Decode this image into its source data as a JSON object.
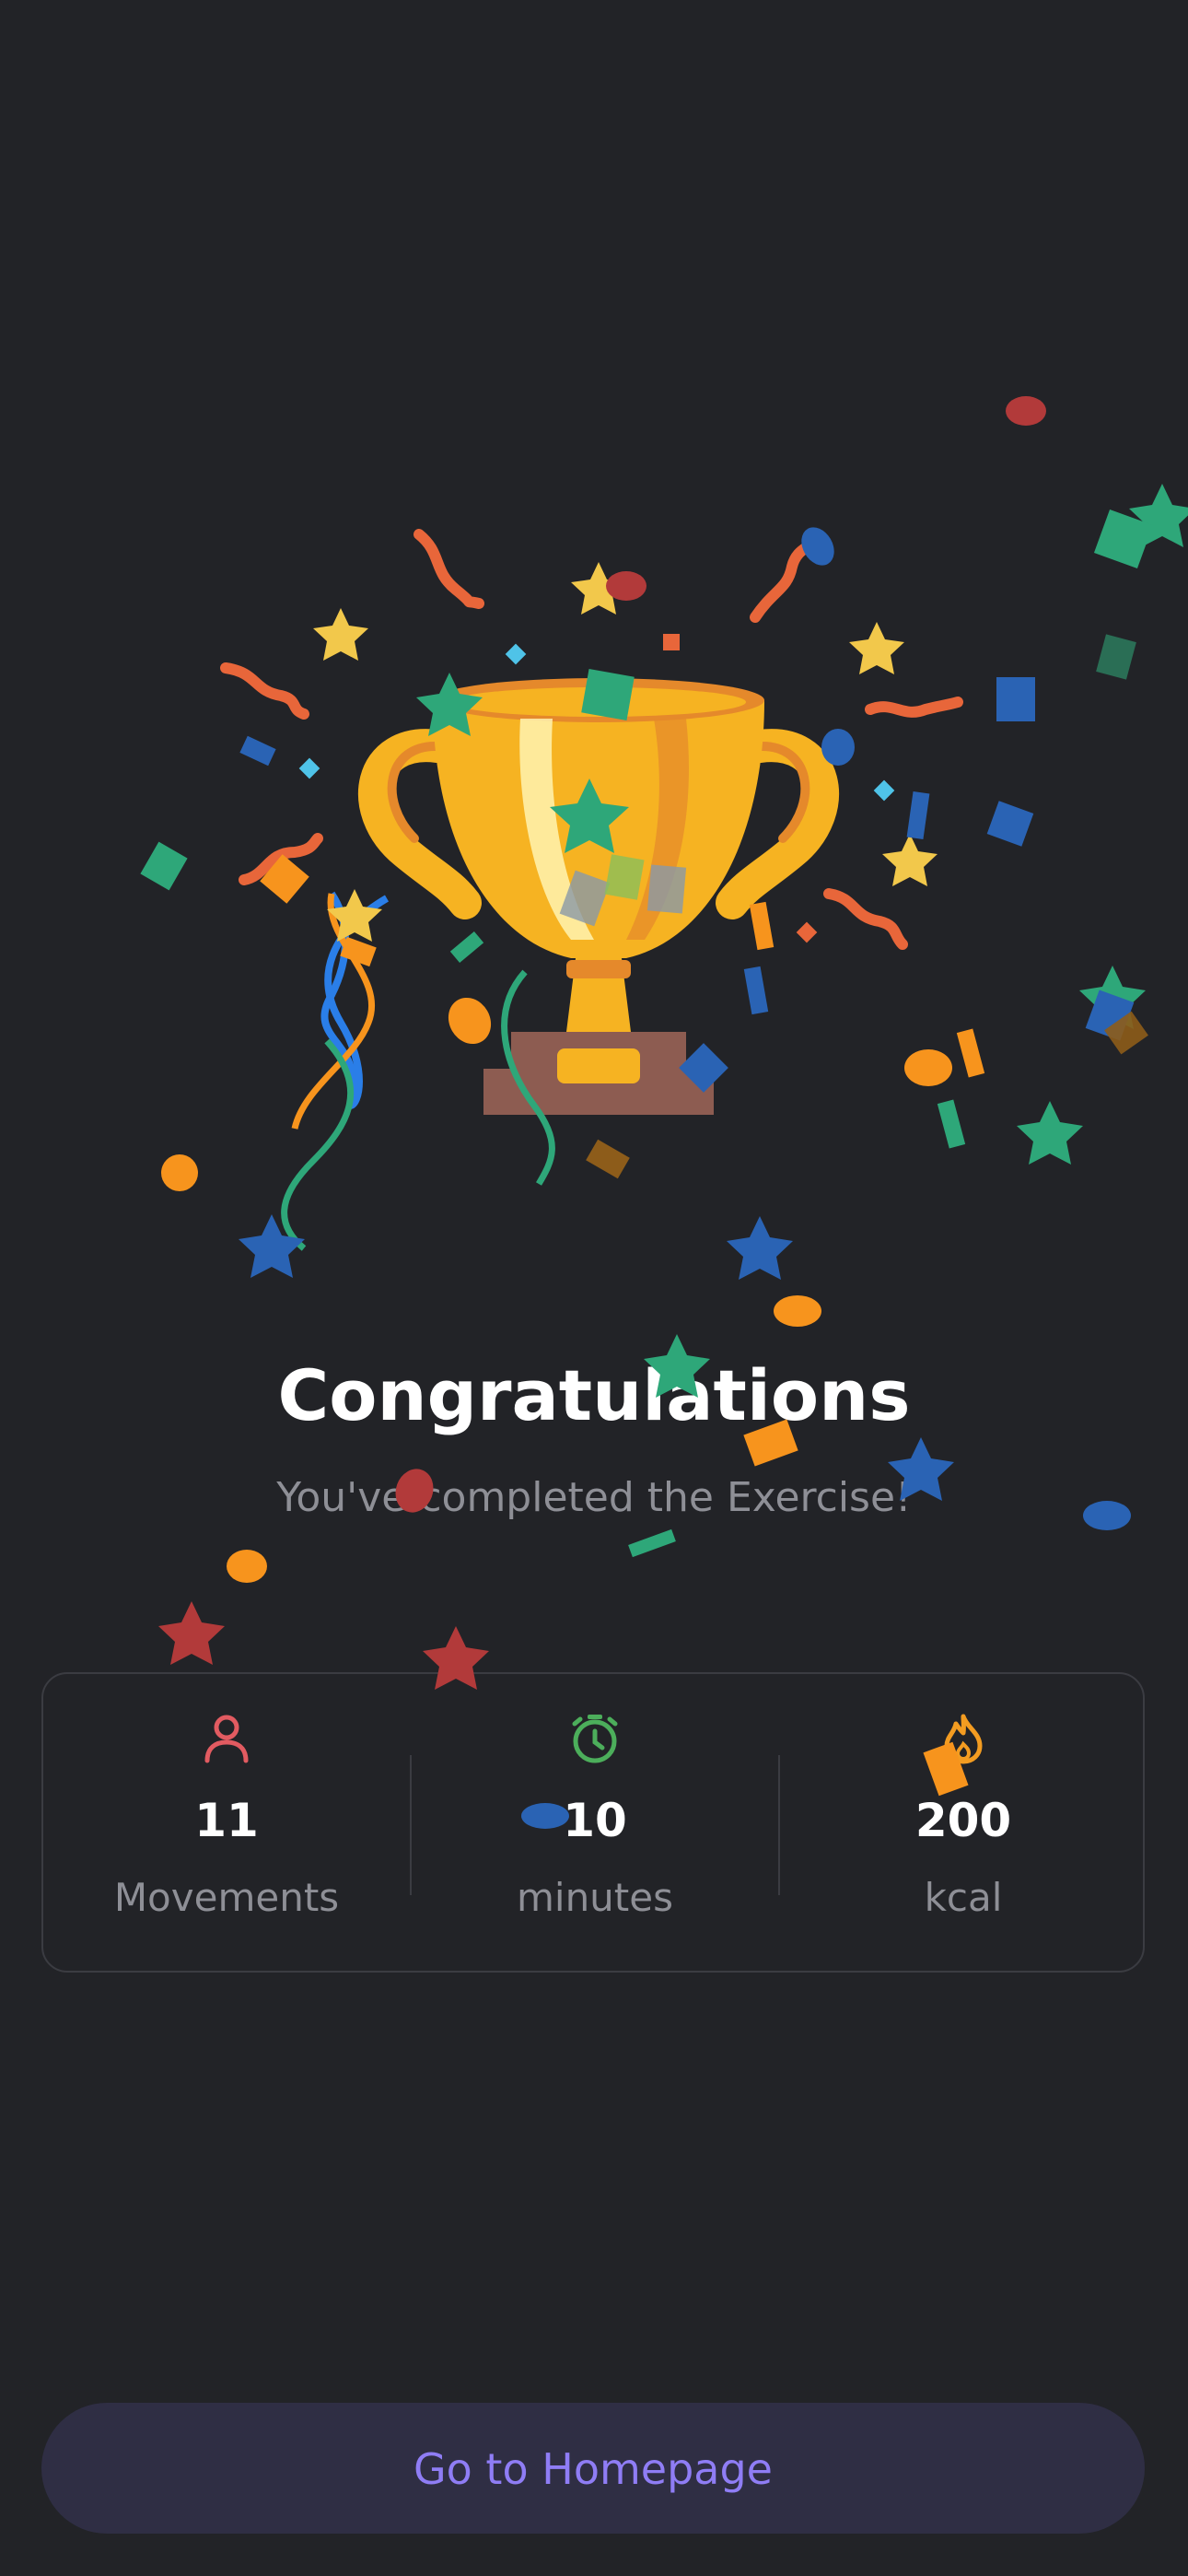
{
  "header": {
    "title": "Congratulations",
    "subtitle": "You've completed the Exercise!"
  },
  "illustration": {
    "icon": "trophy-icon",
    "accent_colors": [
      "#f6b322",
      "#e5892b",
      "#8d5c51",
      "#2ea779",
      "#2a63b4",
      "#f7941d",
      "#f2c84b",
      "#b23a3a",
      "#4fc3e8"
    ]
  },
  "stats": [
    {
      "icon": "person-icon",
      "icon_color": "#e25b61",
      "value": "11",
      "label": "Movements"
    },
    {
      "icon": "stopwatch-icon",
      "icon_color": "#4cae5b",
      "value": "10",
      "label": "minutes"
    },
    {
      "icon": "flame-icon",
      "icon_color": "#f39c21",
      "value": "200",
      "label": "kcal"
    }
  ],
  "actions": {
    "home_label": "Go to Homepage"
  }
}
